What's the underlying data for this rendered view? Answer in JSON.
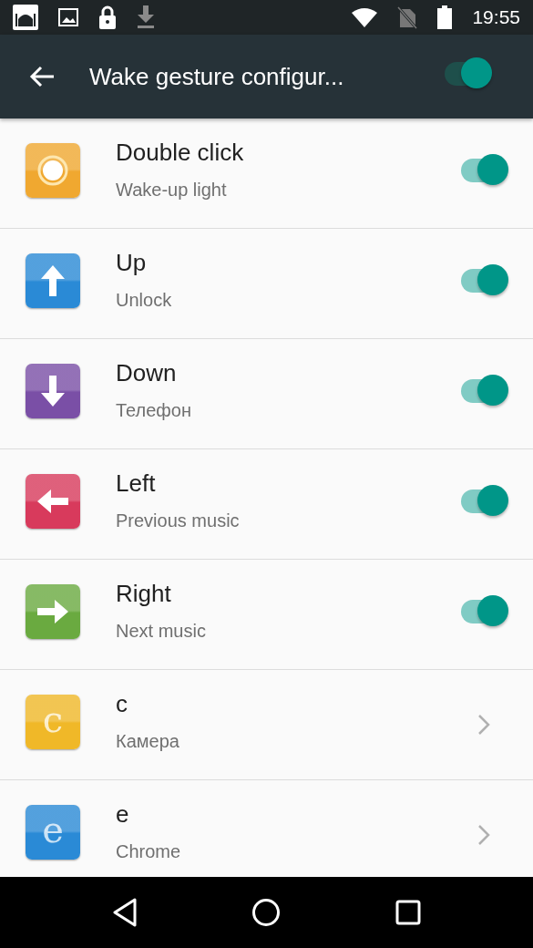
{
  "status_bar": {
    "time": "19:55"
  },
  "toolbar": {
    "title": "Wake gesture configur...",
    "on": true
  },
  "gestures": [
    {
      "title": "Double click",
      "subtitle": "Wake-up light",
      "color": "#f0a830",
      "kind": "switch",
      "on": true
    },
    {
      "title": "Up",
      "subtitle": "Unlock",
      "color": "#2a8ad6",
      "kind": "switch",
      "on": true
    },
    {
      "title": "Down",
      "subtitle": "Телефон",
      "color": "#7a4fa6",
      "kind": "switch",
      "on": true
    },
    {
      "title": "Left",
      "subtitle": "Previous music",
      "color": "#d83a5c",
      "kind": "switch",
      "on": true
    },
    {
      "title": "Right",
      "subtitle": "Next music",
      "color": "#6aaa40",
      "kind": "switch",
      "on": true
    },
    {
      "title": "c",
      "subtitle": "Камера",
      "glyph": "c",
      "color": "#f0b828",
      "kind": "link"
    },
    {
      "title": "e",
      "subtitle": "Chrome",
      "glyph": "e",
      "color": "#2a8ad6",
      "kind": "link"
    }
  ]
}
